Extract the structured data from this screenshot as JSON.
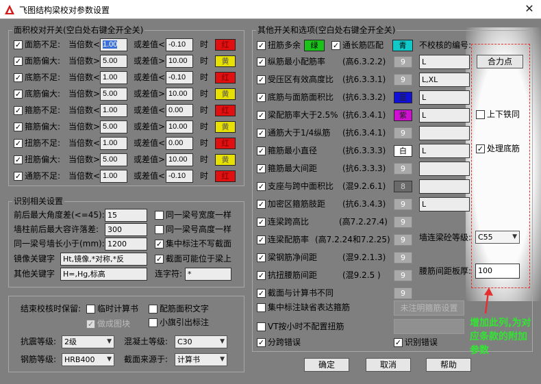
{
  "title": "飞图结构梁校对参数设置",
  "close": "✕",
  "left_group": {
    "title": "面积校对开关(空白处右键全开全关)",
    "rows": [
      {
        "name": "面筋不足:",
        "mult_label": "当倍数<",
        "mult": "1.00",
        "diff_label": "或差值<",
        "diff": "-0.10",
        "time": "时",
        "color_text": "红",
        "color": "#e01010",
        "fg": "#7a0000"
      },
      {
        "name": "面筋偏大:",
        "mult_label": "当倍数>",
        "mult": "5.00",
        "diff_label": "或差值>",
        "diff": "10.00",
        "time": "时",
        "color_text": "黄",
        "color": "#e8e000",
        "fg": "#555"
      },
      {
        "name": "底筋不足:",
        "mult_label": "当倍数<",
        "mult": "1.00",
        "diff_label": "或差值<",
        "diff": "-0.10",
        "time": "时",
        "color_text": "红",
        "color": "#e01010",
        "fg": "#7a0000"
      },
      {
        "name": "底筋偏大:",
        "mult_label": "当倍数>",
        "mult": "5.00",
        "diff_label": "或差值>",
        "diff": "10.00",
        "time": "时",
        "color_text": "黄",
        "color": "#e8e000",
        "fg": "#555"
      },
      {
        "name": "箍筋不足:",
        "mult_label": "当倍数<",
        "mult": "1.00",
        "diff_label": "或差值<",
        "diff": "0.00",
        "time": "时",
        "color_text": "红",
        "color": "#e01010",
        "fg": "#7a0000"
      },
      {
        "name": "箍筋偏大:",
        "mult_label": "当倍数>",
        "mult": "5.00",
        "diff_label": "或差值>",
        "diff": "10.00",
        "time": "时",
        "color_text": "黄",
        "color": "#e8e000",
        "fg": "#555"
      },
      {
        "name": "扭筋不足:",
        "mult_label": "当倍数<",
        "mult": "1.00",
        "diff_label": "或差值<",
        "diff": "0.00",
        "time": "时",
        "color_text": "红",
        "color": "#e01010",
        "fg": "#7a0000"
      },
      {
        "name": "扭筋偏大:",
        "mult_label": "当倍数>",
        "mult": "5.00",
        "diff_label": "或差值>",
        "diff": "10.00",
        "time": "时",
        "color_text": "黄",
        "color": "#e8e000",
        "fg": "#555"
      },
      {
        "name": "通筋不足:",
        "mult_label": "当倍数<",
        "mult": "1.00",
        "diff_label": "或差值<",
        "diff": "-0.10",
        "time": "时",
        "color_text": "红",
        "color": "#e01010",
        "fg": "#7a0000"
      }
    ]
  },
  "ident_group": {
    "title": "识别相关设置",
    "angle_label": "前后最大角度差(<=45):",
    "angle": "15",
    "wall_label": "墙柱前后最大容许落差:",
    "wall": "300",
    "beam_label": "同一梁号墙长小于(mm):",
    "beam": "1200",
    "mirror_label": "镜像关键字",
    "mirror": "Ht,镜像,*对称,*反",
    "other_label": "其他关键字",
    "other": "H=,Hg,标高",
    "conn_label": "连字符:",
    "conn": "*",
    "chk_width": "同一梁号宽度一样",
    "chk_height": "同一梁号高度一样",
    "chk_concentrate": "集中标注不写截面",
    "chk_section": "截面可能位于梁上"
  },
  "end_group": {
    "title": "结束校核时保留:",
    "tmp": "临时计算书",
    "area_text": "配筋面积文字",
    "make_block": "做成图块",
    "small_flag": "小旗引出标注",
    "seismic_label": "抗震等级:",
    "seismic": "2级",
    "concrete_label": "混凝土等级:",
    "concrete": "C30",
    "steel_label": "钢筋等级:",
    "steel": "HRB400",
    "section_label": "截面来源于:",
    "section": "计算书"
  },
  "right_group": {
    "title": "其他开关和选项(空白处右键全开全关)",
    "top_row": {
      "label1": "扭筋多余",
      "green": "绿",
      "label2": "通长筋匹配",
      "cyan": "青",
      "no_check_label": "不校核的编号:"
    },
    "rows": [
      {
        "label": "纵筋最小配筋率",
        "code": "(高6.3.2.2)",
        "sw": "9",
        "val": "L"
      },
      {
        "label": "受压区有效高度比",
        "code": "(抗6.3.3.1)",
        "sw": "9",
        "val": "L,XL"
      },
      {
        "label": "底筋与面筋面积比",
        "code": "(抗6.3.3.2)",
        "sw": "蓝",
        "val": "L"
      },
      {
        "label": "梁配筋率大于2.5%",
        "code": "(抗6.3.4.1)",
        "sw": "紫",
        "val": "L"
      },
      {
        "label": "通筋大于1/4纵筋",
        "code": "(抗6.3.4.1)",
        "sw": "9",
        "val": ""
      },
      {
        "label": "箍筋最小直径",
        "code": "(抗6.3.3.3)",
        "sw": "白",
        "val": "L"
      },
      {
        "label": "箍筋最大间距",
        "code": "(抗6.3.3.3)",
        "sw": "9",
        "val": ""
      },
      {
        "label": "支座与跨中面积比",
        "code": "(混9.2.6.1)",
        "sw": "8",
        "val": ""
      },
      {
        "label": "加密区箍筋肢距",
        "code": "(抗6.3.4.3)",
        "sw": "9",
        "val": "L"
      },
      {
        "label": "连梁跨高比",
        "code": "(高7.2.27.4)",
        "sw": "9",
        "val": ""
      },
      {
        "label": "连梁配筋率",
        "code": "(高7.2.24和7.2.25)",
        "sw": "9",
        "val": ""
      },
      {
        "label": "梁钢筋净间距",
        "code": "(混9.2.1.3)",
        "sw": "9",
        "val": ""
      },
      {
        "label": "抗扭腰筋间距",
        "code": "(混9.2.5 )",
        "sw": "9",
        "val": ""
      },
      {
        "label": "截面与计算书不同",
        "code": "",
        "sw": "9",
        "val": ""
      }
    ],
    "concentrate": "集中标注缺省表达箍筋",
    "unmark_btn": "未注明箍筋设置",
    "vt": "VT按小时不配置扭筋",
    "span_err": "分跨错误",
    "ident_err": "识别错误",
    "hl_btn": "合力点",
    "updown": "上下铁同",
    "bottom": "处理底筋",
    "wall_grade_label": "墙连梁砼等级:",
    "wall_grade": "C55",
    "waist_label": "腰筋间距板厚:",
    "waist": "100"
  },
  "buttons": {
    "ok": "确定",
    "cancel": "取消",
    "help": "帮助"
  },
  "annotation": "增加此列,为对应条款的附加参数"
}
